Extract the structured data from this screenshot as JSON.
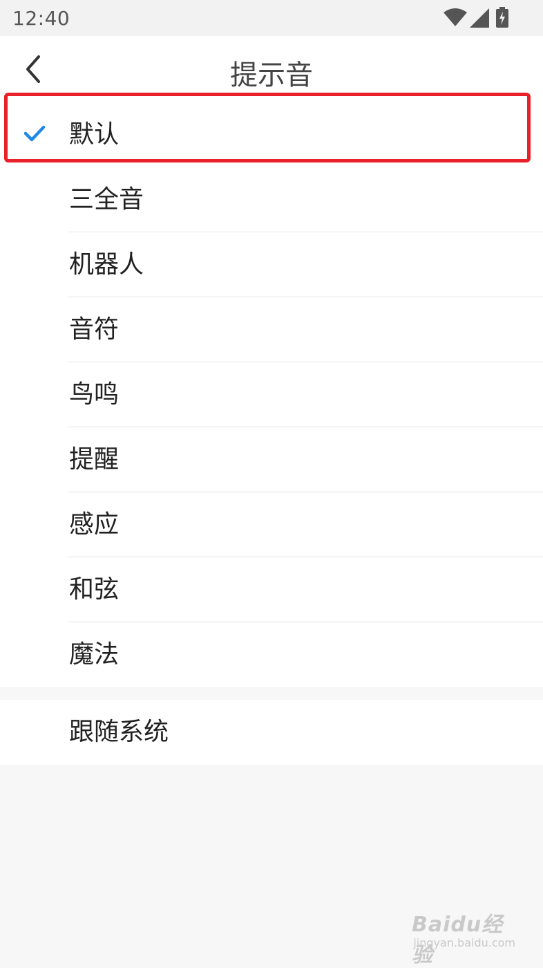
{
  "status_bar": {
    "time": "12:40",
    "icons": [
      "wifi-icon",
      "cellular-signal-icon",
      "battery-charging-icon"
    ]
  },
  "header": {
    "title": "提示音",
    "back_icon": "chevron-left-icon"
  },
  "options": [
    {
      "label": "默认",
      "selected": true
    },
    {
      "label": "三全音",
      "selected": false
    },
    {
      "label": "机器人",
      "selected": false
    },
    {
      "label": "音符",
      "selected": false
    },
    {
      "label": "鸟鸣",
      "selected": false
    },
    {
      "label": "提醒",
      "selected": false
    },
    {
      "label": "感应",
      "selected": false
    },
    {
      "label": "和弦",
      "selected": false
    },
    {
      "label": "魔法",
      "selected": false
    }
  ],
  "system_option": {
    "label": "跟随系统"
  },
  "colors": {
    "accent": "#1e88e5",
    "highlight_border": "#e8202a",
    "background": "#f7f7f7"
  },
  "watermark": {
    "brand": "Baidu经验",
    "url": "jingyan.baidu.com"
  }
}
